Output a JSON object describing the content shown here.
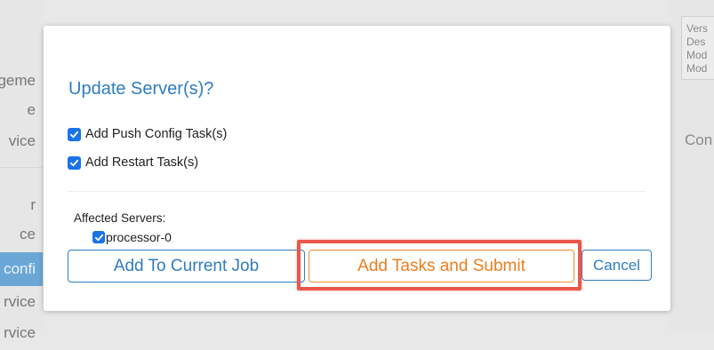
{
  "background": {
    "left_items": [
      "geme",
      "e",
      "vice",
      "r",
      "ce",
      "confi",
      "rvice",
      "rvice"
    ],
    "right_lines": [
      "Vers",
      "Des",
      "Mod",
      "Mod"
    ],
    "right_heading": "Con"
  },
  "modal": {
    "title": "Update Server(s)?",
    "options": [
      {
        "label": "Add Push Config Task(s)",
        "checked": true
      },
      {
        "label": "Add Restart Task(s)",
        "checked": true
      }
    ],
    "affected_label": "Affected Servers:",
    "servers": [
      {
        "name": "processor-0",
        "checked": true
      }
    ],
    "buttons": {
      "add_to_job": "Add To Current Job",
      "submit": "Add Tasks and Submit",
      "cancel": "Cancel"
    }
  },
  "colors": {
    "accent_blue": "#2f7cc3",
    "checkbox_blue": "#1a73e8",
    "submit_orange": "#ef7d1d",
    "highlight_red": "#e8574c"
  }
}
